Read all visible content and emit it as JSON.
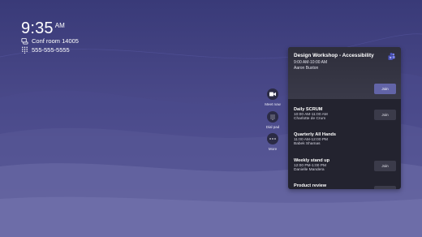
{
  "clock": {
    "time": "9:35",
    "ampm": "AM"
  },
  "room": {
    "name": "Conf room 14005",
    "phone": "555-555-5555"
  },
  "actions": [
    {
      "label": "Meet now",
      "icon": "video-camera-icon"
    },
    {
      "label": "Dial pad",
      "icon": "dial-pad-icon"
    },
    {
      "label": "More",
      "icon": "more-icon"
    }
  ],
  "featured": {
    "title": "Design Workshop - Accessibility",
    "time": "9:00 AM-10:00 AM",
    "organizer": "Aaron Buxton",
    "join_label": "Join"
  },
  "meetings": [
    {
      "title": "Daily SCRUM",
      "time": "10:00 AM-11:00 AM",
      "organizer": "Charlotte de Crum",
      "join_label": "Join"
    },
    {
      "title": "Quarterly All Hands",
      "time": "11:00 AM-12:00 PM",
      "organizer": "Babek Shamas",
      "join_label": ""
    },
    {
      "title": "Weekly stand up",
      "time": "12:00 PM-1:00 PM",
      "organizer": "Danielle Mandera",
      "join_label": "Join"
    },
    {
      "title": "Product review",
      "time": "",
      "organizer": "",
      "join_label": ""
    }
  ],
  "colors": {
    "accent": "#6264a7",
    "panel": "#23232f",
    "background": "#3f3f80"
  }
}
